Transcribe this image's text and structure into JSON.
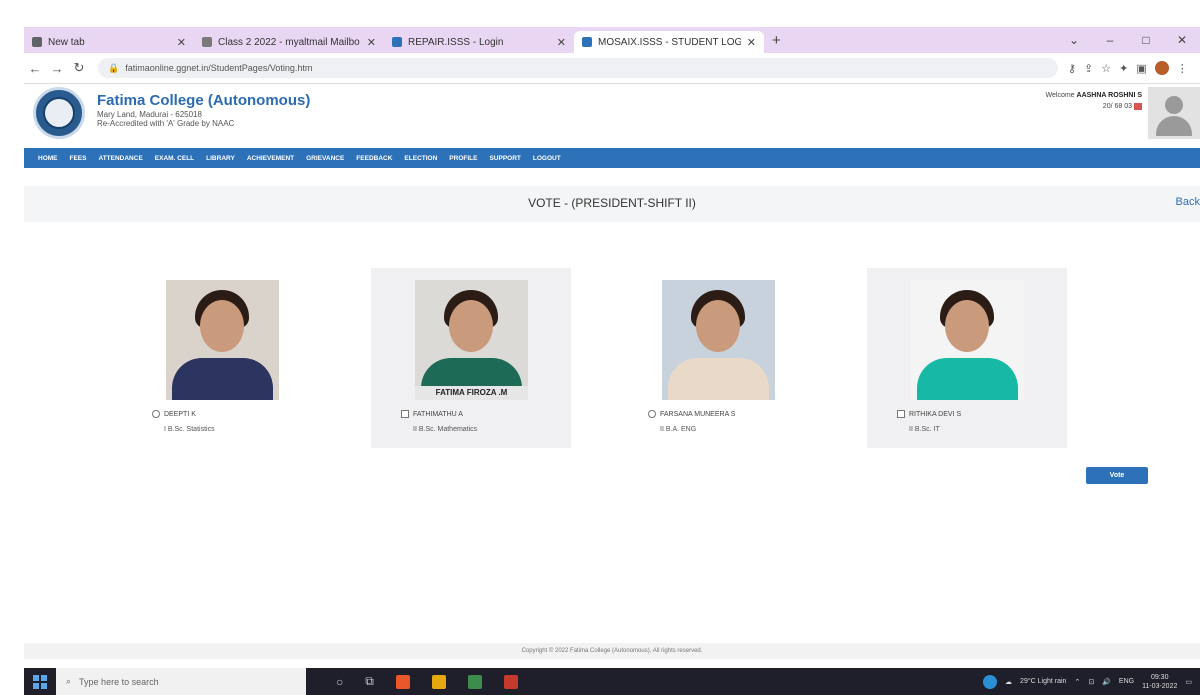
{
  "browser": {
    "tabs": [
      {
        "title": "New tab",
        "favicon_color": "#5f6368",
        "active": false
      },
      {
        "title": "Class 2 2022 - myaltmail Mailbo",
        "favicon_color": "#7a7a7a",
        "active": false
      },
      {
        "title": "REPAIR.ISSS - Login",
        "favicon_color": "#2d71b8",
        "active": false
      },
      {
        "title": "MOSAIX.ISSS - STUDENT LOGIN",
        "favicon_color": "#2d71b8",
        "active": true
      }
    ],
    "new_tab": "+",
    "window_controls": [
      "⌄",
      "–",
      "□",
      "✕"
    ],
    "url": "fatimaonline.ggnet.in/StudentPages/Voting.htm",
    "nav": [
      "←",
      "→",
      "↻"
    ]
  },
  "site": {
    "college_name": "Fatima College (Autonomous)",
    "address_line1": "Mary Land, Madurai - 625018",
    "address_line2": "Re-Accredited with 'A' Grade by NAAC",
    "welcome_prefix": "Welcome",
    "user_name": "AASHNA ROSHNI S",
    "user_id": "20/ 68 03",
    "menu": [
      "HOME",
      "FEES",
      "ATTENDANCE",
      "EXAM. CELL",
      "LIBRARY",
      "ACHIEVEMENT",
      "GRIEVANCE",
      "FEEDBACK",
      "ELECTION",
      "PROFILE",
      "SUPPORT",
      "LOGOUT"
    ]
  },
  "vote": {
    "heading": "VOTE - (PRESIDENT-SHIFT II)",
    "back_label": "Back",
    "vote_button": "Vote",
    "candidates": [
      {
        "name": "DEEPTI K",
        "dept": "I B.Sc. Statistics",
        "caption": "",
        "selector": "radio"
      },
      {
        "name": "FATHIMATHU A",
        "dept": "II B.Sc. Mathematics",
        "caption": "FATIMA FIROZA .M",
        "selector": "checkbox"
      },
      {
        "name": "FARSANA MUNEERA S",
        "dept": "II B.A. ENG",
        "caption": "",
        "selector": "radio"
      },
      {
        "name": "RITHIKA DEVI S",
        "dept": "II B.Sc. IT",
        "caption": "",
        "selector": "checkbox"
      }
    ]
  },
  "footer_text": "Copyright © 2022 Fatima College (Autonomous). All rights reserved.",
  "taskbar": {
    "search_placeholder": "Type here to search",
    "weather": "29°C  Light rain",
    "lang": "ENG",
    "time": "09:30",
    "date": "11-03-2022"
  }
}
